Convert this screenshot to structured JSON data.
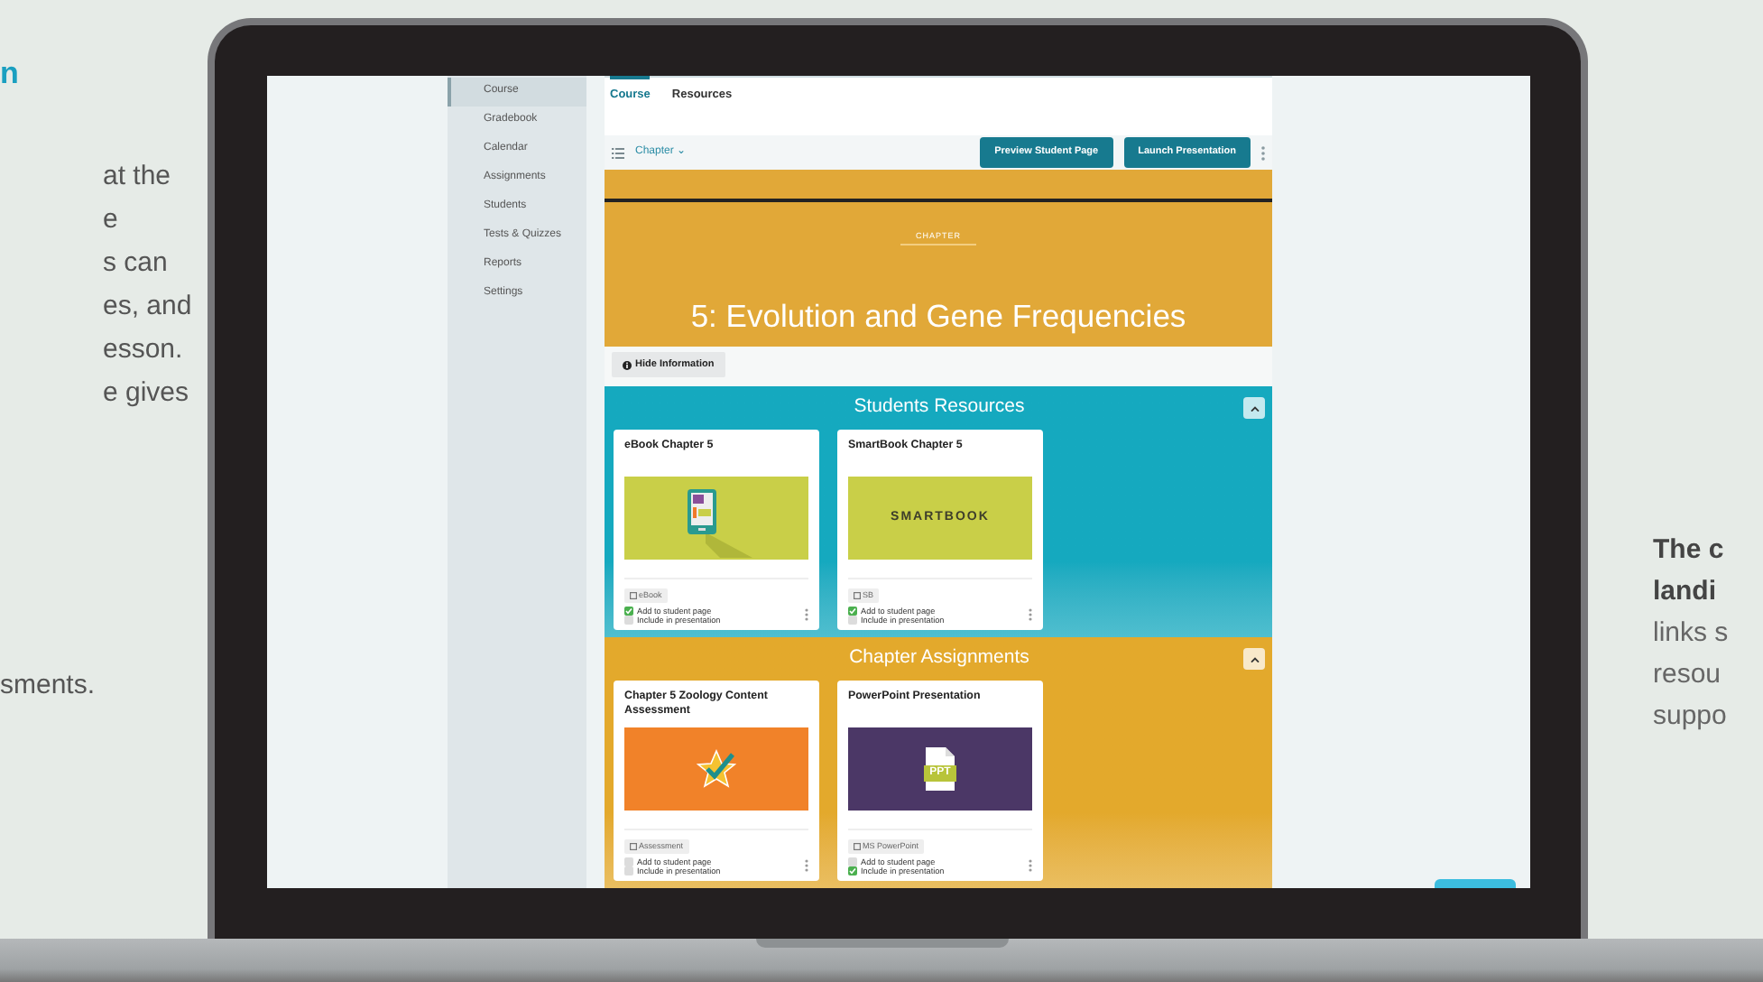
{
  "left_text": {
    "heading": "n",
    "lines": [
      "at the",
      "e",
      "s can",
      "es, and",
      "esson.",
      "e gives"
    ],
    "last_line": "sments."
  },
  "screen": {
    "sidebar": [
      {
        "label": "Course",
        "selected": true
      },
      {
        "label": "Gradebook",
        "selected": false
      },
      {
        "label": "Calendar",
        "selected": false
      },
      {
        "label": "Assignments",
        "selected": false
      },
      {
        "label": "Students",
        "selected": false
      },
      {
        "label": "Tests & Quizzes",
        "selected": false
      },
      {
        "label": "Reports",
        "selected": false
      },
      {
        "label": "Settings",
        "selected": false
      }
    ],
    "tabs": [
      {
        "label": "Course",
        "selected": true
      },
      {
        "label": "Resources",
        "selected": false
      }
    ],
    "toolbar": {
      "dropdown": "Chapter",
      "caret": "⌄",
      "buttons": [
        "Preview Student Page",
        "Launch Presentation"
      ]
    },
    "banner": {
      "eyebrow": "CHAPTER",
      "title": "5: Evolution and Gene Frequencies"
    },
    "info_button": "Hide Information",
    "sections": [
      {
        "title": "Students Resources",
        "color": "#15a9bf",
        "cards": [
          {
            "title": "eBook Chapter 5",
            "thumb": {
              "kind": "ebook"
            },
            "tag": "eBook",
            "options": [
              {
                "label": "Add to student page",
                "checked": true
              },
              {
                "label": "Include in presentation",
                "checked": false
              }
            ]
          },
          {
            "title": "SmartBook Chapter 5",
            "thumb": {
              "kind": "smartbook",
              "label": "SMARTBOOK"
            },
            "tag": "SB",
            "options": [
              {
                "label": "Add to student page",
                "checked": true
              },
              {
                "label": "Include in presentation",
                "checked": false
              }
            ]
          }
        ]
      },
      {
        "title": "Chapter Assignments",
        "color": "#e3a92c",
        "cards": [
          {
            "title": "Chapter 5 Zoology Content Assessment",
            "thumb": {
              "kind": "assessment"
            },
            "tag": "Assessment",
            "options": [
              {
                "label": "Add to student page",
                "checked": false
              },
              {
                "label": "Include in presentation",
                "checked": false
              }
            ]
          },
          {
            "title": "PowerPoint Presentation",
            "thumb": {
              "kind": "ppt",
              "label": "PPT"
            },
            "tag": "MS PowerPoint",
            "options": [
              {
                "label": "Add to student page",
                "checked": false
              },
              {
                "label": "Include in presentation",
                "checked": true
              }
            ]
          }
        ]
      }
    ]
  },
  "right_text": {
    "bold_lines": [
      "The c",
      "landi"
    ],
    "lines": [
      "links s",
      "resou",
      "suppo"
    ]
  }
}
